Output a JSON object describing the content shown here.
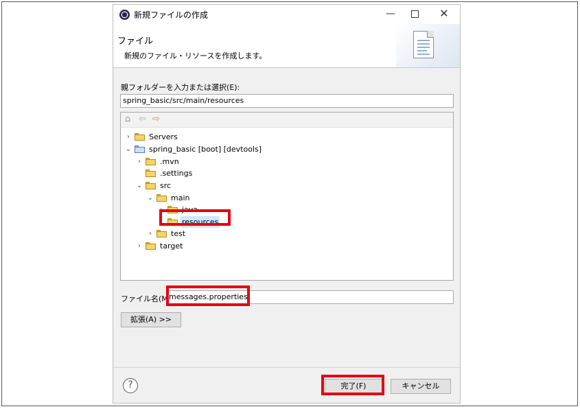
{
  "window": {
    "title": "新規ファイルの作成",
    "min_glyph": "—",
    "close_glyph": "✕"
  },
  "banner": {
    "title": "ファイル",
    "description": "新規のファイル・リソースを作成します。"
  },
  "parent_folder": {
    "label": "親フォルダーを入力または選択(E):",
    "value": "spring_basic/src/main/resources"
  },
  "tree_toolbar": {
    "home_icon": "⌂",
    "back_icon": "⇦",
    "forward_icon": "⇨"
  },
  "tree": {
    "expanded_glyph": "⌄",
    "collapsed_glyph": "›",
    "items": [
      {
        "label": "Servers",
        "expanded": false
      },
      {
        "label": "spring_basic [boot] [devtools]",
        "expanded": true
      },
      {
        "label": ".mvn",
        "expanded": false
      },
      {
        "label": ".settings"
      },
      {
        "label": "src",
        "expanded": true
      },
      {
        "label": "main",
        "expanded": true
      },
      {
        "label": "java",
        "expanded": false
      },
      {
        "label": "resources",
        "selected": true
      },
      {
        "label": "test",
        "expanded": false
      },
      {
        "label": "target",
        "expanded": false
      }
    ]
  },
  "file_name": {
    "label": "ファイル名(M):",
    "value": "messages.properties"
  },
  "buttons": {
    "advanced": "拡張(A) >>",
    "finish": "完了(F)",
    "cancel": "キャンセル",
    "help": "?"
  },
  "colors": {
    "highlight_box": "#e60012",
    "selection": "#cce8ff",
    "folder": "#f7d46a"
  }
}
